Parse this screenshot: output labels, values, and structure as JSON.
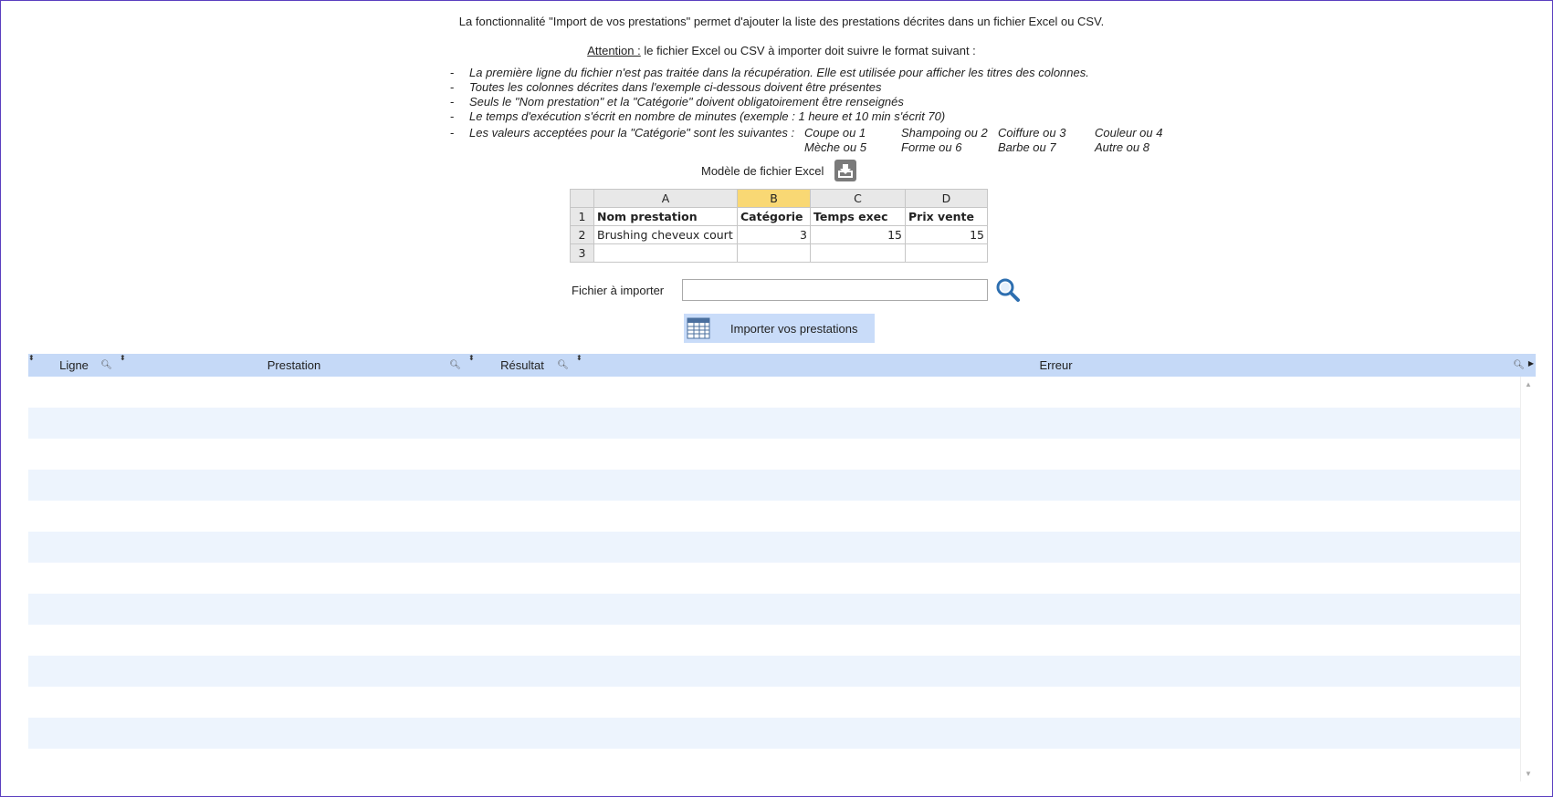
{
  "intro": "La fonctionnalité \"Import de vos prestations\" permet d'ajouter la liste des prestations décrites dans un fichier Excel ou CSV.",
  "warning": {
    "label": "Attention :",
    "text": " le fichier Excel ou CSV à importer doit suivre le format suivant :"
  },
  "rules": [
    "La première ligne du fichier n'est pas traitée dans la récupération. Elle est utilisée pour afficher les titres des colonnes.",
    "Toutes les colonnes décrites dans l'exemple ci-dessous doivent être présentes",
    "Seuls le \"Nom prestation\" et la \"Catégorie\" doivent obligatoirement être renseignés",
    "Le temps d'exécution  s'écrit en nombre de minutes (exemple : 1 heure et 10 min s'écrit 70)",
    "Les valeurs acceptées pour la \"Catégorie\" sont les suivantes :"
  ],
  "dash": "-",
  "categories": [
    [
      "Coupe ou 1",
      "Shampoing ou 2",
      "Coiffure ou 3",
      "Couleur ou 4"
    ],
    [
      "Mèche ou 5",
      "Forme ou 6",
      "Barbe ou 7",
      "Autre ou 8"
    ]
  ],
  "model_label": "Modèle de fichier Excel",
  "excel": {
    "columns": [
      "A",
      "B",
      "C",
      "D"
    ],
    "rows": [
      {
        "n": "1",
        "cells": [
          "Nom prestation",
          "Catégorie",
          "Temps exec",
          "Prix vente"
        ]
      },
      {
        "n": "2",
        "cells": [
          "Brushing cheveux court",
          "3",
          "15",
          "15"
        ]
      },
      {
        "n": "3",
        "cells": [
          "",
          "",
          "",
          ""
        ]
      }
    ]
  },
  "file_label": "Fichier à importer",
  "file_value": "",
  "import_label": "Importer vos prestations",
  "grid": {
    "columns": [
      "Ligne",
      "Prestation",
      "Résultat",
      "Erreur"
    ]
  }
}
